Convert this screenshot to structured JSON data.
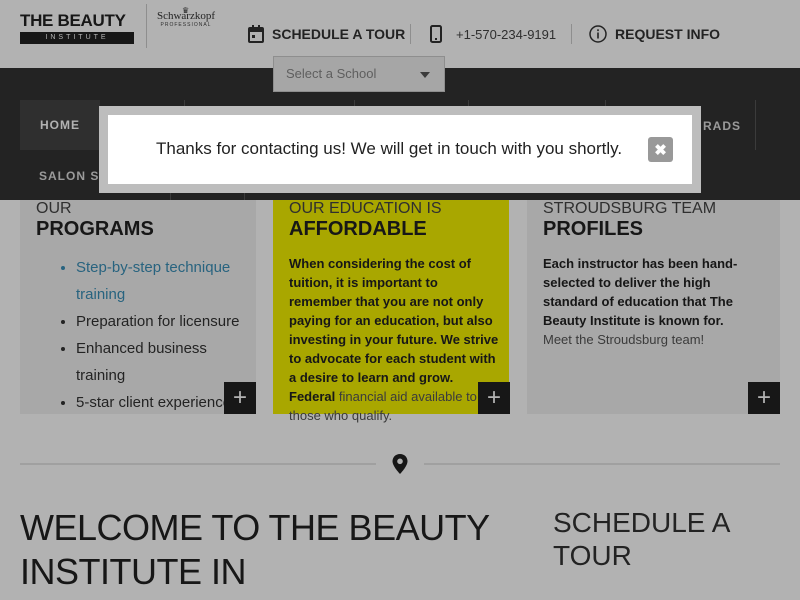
{
  "header": {
    "logo_main": "THE BEAUTY",
    "logo_sub": "INSTITUTE",
    "partner_name": "Schwarzkopf",
    "partner_sub": "PROFESSIONAL",
    "schedule_label": "SCHEDULE A TOUR",
    "phone": "+1-570-234-9191",
    "request_label": "REQUEST INFO",
    "school_select_placeholder": "Select a School"
  },
  "nav": {
    "home": "HOME",
    "salon_partial": "SALON SE",
    "grads_partial": "RADS"
  },
  "cards": [
    {
      "kicker": "OUR",
      "title": "PROGRAMS",
      "items": [
        "Step-by-step technique training",
        "Preparation for licensure",
        "Enhanced business training",
        "5-star client experience"
      ]
    },
    {
      "kicker": "OUR EDUCATION IS",
      "title": "AFFORDABLE",
      "body": "When considering the cost of tuition, it is important to remember that you are not only paying for an education, but also investing in your future. We strive to advocate for each student with a desire to learn and grow. Federal",
      "body_light": "financial aid available to those who qualify."
    },
    {
      "kicker": "STROUDSBURG TEAM",
      "title": "PROFILES",
      "body": "Each instructor has been hand-selected to deliver the high standard of education that The Beauty Institute is known for.",
      "body_light": "Meet the Stroudsburg team!"
    }
  ],
  "main": {
    "welcome": "WELCOME TO THE BEAUTY INSTITUTE IN",
    "schedule_title": "SCHEDULE A TOUR"
  },
  "modal": {
    "message": "Thanks for contacting us! We will get in touch with you shortly.",
    "close_symbol": "✖"
  },
  "colors": {
    "yellow_card": "#f2ef00",
    "link": "#3a8fb7",
    "nav_bg": "#333333"
  }
}
